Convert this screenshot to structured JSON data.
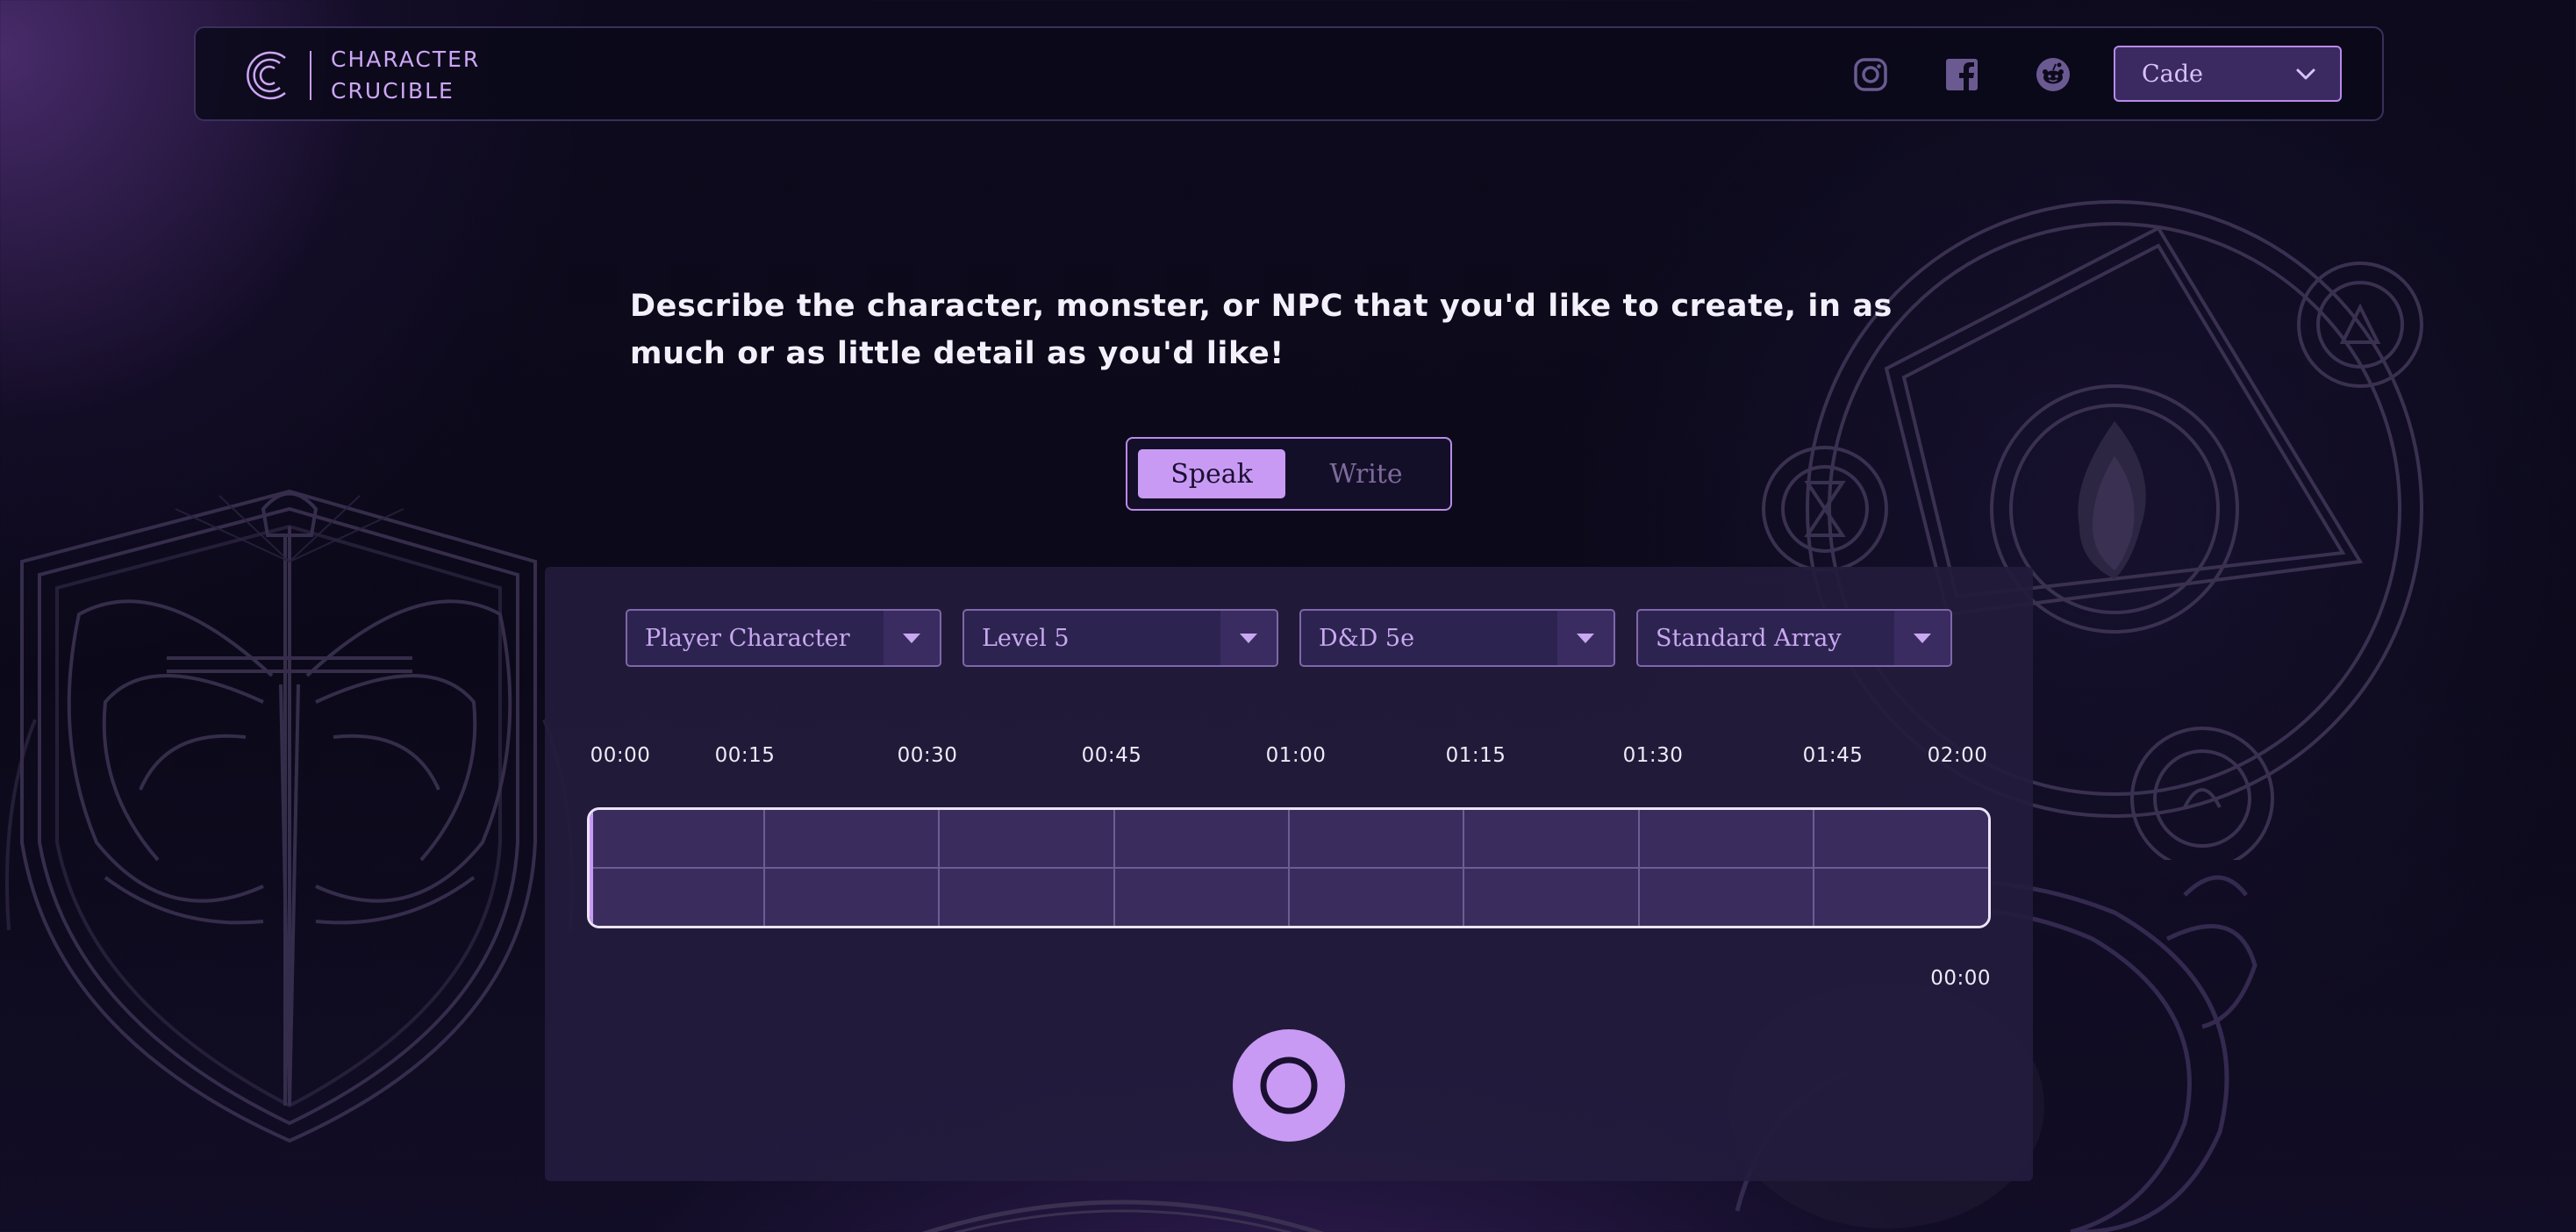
{
  "header": {
    "logo_line1": "CHARACTER",
    "logo_line2": "CRUCIBLE",
    "social": [
      {
        "icon": "instagram-icon"
      },
      {
        "icon": "facebook-icon"
      },
      {
        "icon": "reddit-icon"
      }
    ],
    "user_select": {
      "value": "Cade"
    }
  },
  "main": {
    "prompt": "Describe the character, monster, or NPC that you'd like to create, in as much or as little detail as you'd like!",
    "mode_toggle": {
      "options": [
        "Speak",
        "Write"
      ],
      "selected": "Speak"
    },
    "dropdowns": [
      {
        "value": "Player Character"
      },
      {
        "value": "Level 5"
      },
      {
        "value": "D&D 5e"
      },
      {
        "value": "Standard Array"
      }
    ],
    "timeline": {
      "ticks": [
        "00:00",
        "00:15",
        "00:30",
        "00:45",
        "01:00",
        "01:15",
        "01:30",
        "01:45",
        "02:00"
      ],
      "elapsed": "00:00",
      "progress": 0
    }
  },
  "colors": {
    "accent": "#c89af4",
    "accent_dark": "#3b2a62",
    "background": "#0c0a1b",
    "panel": "#231c3c"
  }
}
